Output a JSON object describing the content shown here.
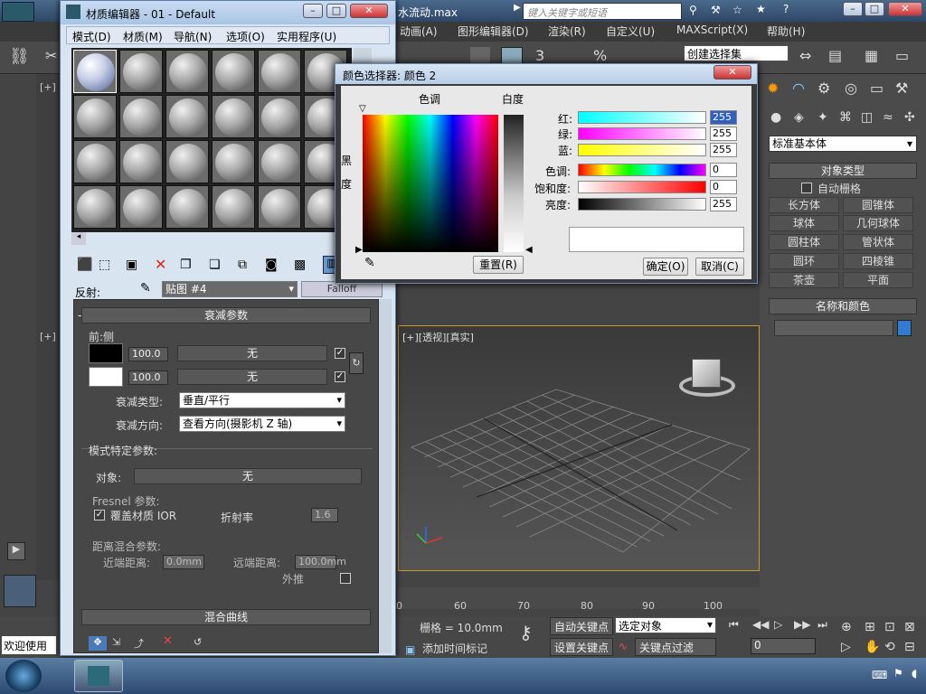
{
  "main": {
    "title_fragment": "水流动.max",
    "search_placeholder": "键入关键字或短语",
    "menu": [
      "动画(A)",
      "图形编辑器(D)",
      "渲染(R)",
      "自定义(U)",
      "MAXScript(X)",
      "帮助(H)"
    ],
    "selection_set": "创建选择集",
    "viewport_labels": [
      "[+]",
      "[+]"
    ],
    "viewport_label": "[+][透视][真实]",
    "timeline_ticks": [
      "60",
      "70",
      "80",
      "90",
      "100"
    ],
    "timeline_first": "0",
    "status": {
      "welcome": "欢迎使用",
      "grid": "栅格 = 10.0mm",
      "add_tag": "添加时间标记",
      "auto_key": "自动关键点",
      "set_key": "设置关键点",
      "selected_obj": "选定对象",
      "key_filter": "关键点过滤器...",
      "frame": "0"
    },
    "right_panel": {
      "category": "标准基本体",
      "object_type": "对象类型",
      "auto_grid": "自动栅格",
      "buttons": [
        "长方体",
        "圆锥体",
        "球体",
        "几何球体",
        "圆柱体",
        "管状体",
        "圆环",
        "四棱锥",
        "茶壶",
        "平面"
      ],
      "name_color": "名称和颜色",
      "accent": "#2f7dd1"
    }
  },
  "material_editor": {
    "title": "材质编辑器 - 01 - Default",
    "menu": [
      "模式(D)",
      "材质(M)",
      "导航(N)",
      "选项(O)",
      "实用程序(U)"
    ],
    "reflect_label": "反射:",
    "map_name": "贴图 #4",
    "map_type": "Falloff",
    "falloff_params": "衰减参数",
    "front_side": "前:侧",
    "slot1_value": "100.0",
    "slot2_value": "100.0",
    "none1": "无",
    "none2": "无",
    "falloff_type_label": "衰减类型:",
    "falloff_type_value": "垂直/平行",
    "falloff_dir_label": "衰减方向:",
    "falloff_dir_value": "查看方向(摄影机 Z 轴)",
    "mode_params": "模式特定参数:",
    "object_label": "对象:",
    "object_value": "无",
    "fresnel_label": "Fresnel 参数:",
    "override_ior": "覆盖材质 IOR",
    "ior_label": "折射率",
    "ior_value": "1.6",
    "distance_blend": "距离混合参数:",
    "near_label": "近端距离:",
    "near_value": "0.0mm",
    "far_label": "远端距离:",
    "far_value": "100.0mm",
    "extrapolate": "外推",
    "mix_curve": "混合曲线"
  },
  "color_picker": {
    "title": "颜色选择器: 颜色 2",
    "hue_label": "色调",
    "whiteness_label": "白度",
    "blackness_label": "黑度",
    "red_label": "红:",
    "green_label": "绿:",
    "blue_label": "蓝:",
    "hue_val_label": "色调:",
    "sat_label": "饱和度:",
    "val_label": "亮度:",
    "red": "255",
    "green": "255",
    "blue": "255",
    "hue": "0",
    "sat": "0",
    "value": "255",
    "reset": "重置(R)",
    "ok": "确定(O)",
    "cancel": "取消(C)",
    "preview_color": "#ffffff"
  }
}
